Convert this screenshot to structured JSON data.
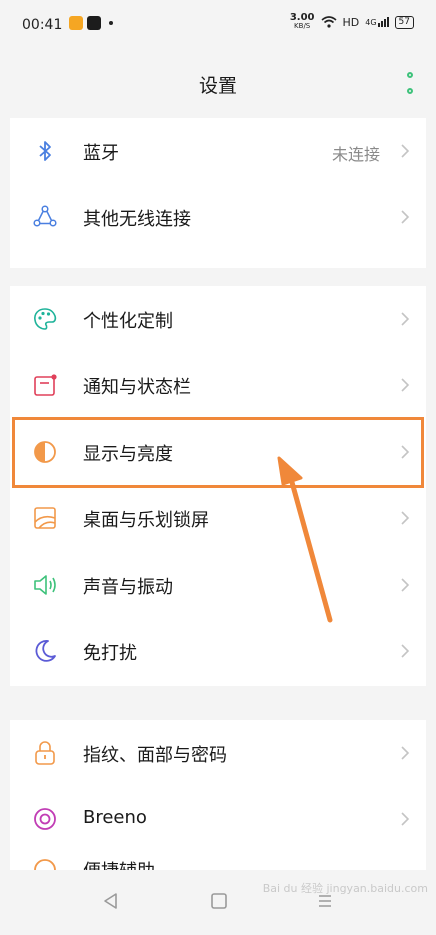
{
  "status_bar": {
    "time": "00:41",
    "speed_value": "3.00",
    "speed_unit": "KB/S",
    "network": "HD",
    "signal": "4G",
    "battery": "57"
  },
  "header": {
    "title": "设置"
  },
  "group1": [
    {
      "label": "蓝牙",
      "value": "未连接",
      "icon": "bluetooth-icon"
    },
    {
      "label": "其他无线连接",
      "value": "",
      "icon": "wireless-connect-icon"
    }
  ],
  "group2": [
    {
      "label": "个性化定制",
      "icon": "palette-icon"
    },
    {
      "label": "通知与状态栏",
      "icon": "notification-icon"
    },
    {
      "label": "显示与亮度",
      "icon": "brightness-icon"
    },
    {
      "label": "桌面与乐划锁屏",
      "icon": "wallpaper-icon"
    },
    {
      "label": "声音与振动",
      "icon": "speaker-icon"
    },
    {
      "label": "免打扰",
      "icon": "moon-icon"
    }
  ],
  "group3": [
    {
      "label": "指纹、面部与密码",
      "icon": "lock-icon"
    },
    {
      "label": "Breeno",
      "icon": "breeno-icon"
    },
    {
      "label": "便捷辅助",
      "icon": "assist-icon"
    }
  ],
  "watermark": "Bai du 经验 jingyan.baidu.com",
  "colors": {
    "accent_green": "#3ec27b",
    "highlight": "#f0883a"
  }
}
